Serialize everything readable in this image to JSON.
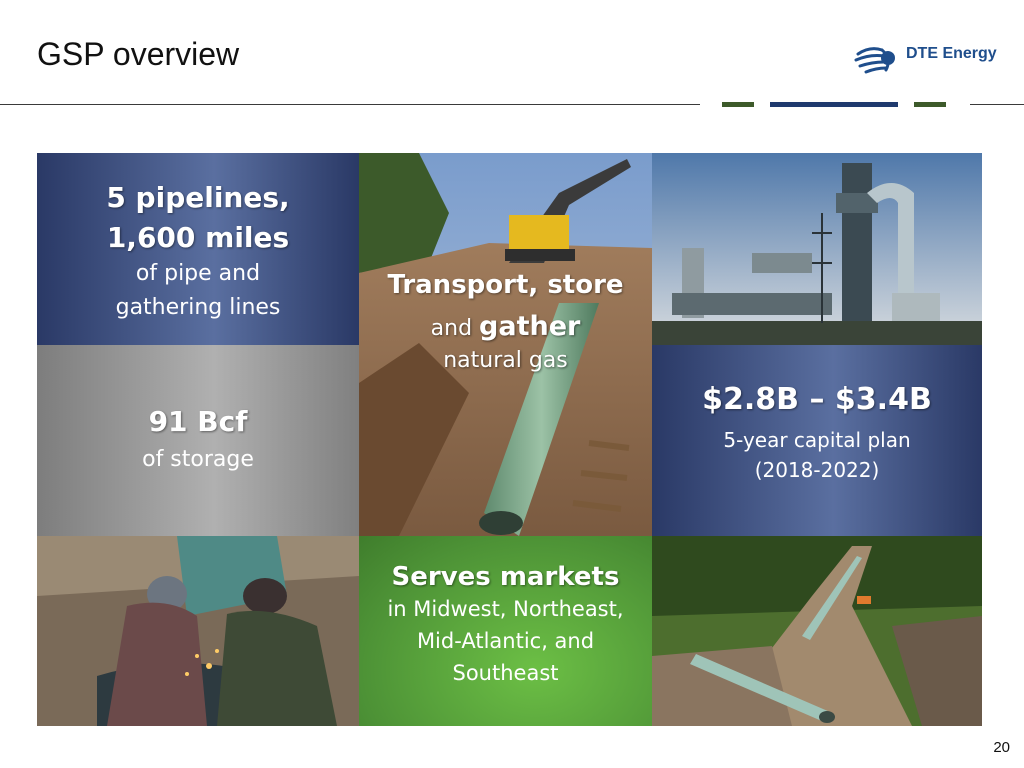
{
  "header": {
    "title": "GSP overview",
    "logo_text": "DTE Energy"
  },
  "tiles": {
    "pipelines": {
      "headline": "5 pipelines, 1,600 miles",
      "line1": "5 pipelines,",
      "line2": "1,600 miles",
      "sub1": "of pipe and",
      "sub2": "gathering lines"
    },
    "transport": {
      "line1": "Transport, store",
      "and_word": "and",
      "gather_word": "gather",
      "sub": "natural gas"
    },
    "storage": {
      "headline": "91 Bcf",
      "sub": "of storage"
    },
    "capital": {
      "headline": "$2.8B – $3.4B",
      "sub1": "5-year capital plan",
      "sub2": "(2018-2022)"
    },
    "markets": {
      "headline": "Serves markets",
      "sub1": "in Midwest, Northeast,",
      "sub2": "Mid-Atlantic, and",
      "sub3": "Southeast"
    }
  },
  "images": {
    "excavator": "trench-excavator-photo",
    "plant": "gas-facility-photo",
    "welders": "welders-photo",
    "pipeline_row": "pipeline-right-of-way-photo"
  },
  "colors": {
    "navy": "#2b3a6b",
    "grey": "#8c8c8c",
    "green": "#5aa23e",
    "accent_green": "#3d5a2a",
    "accent_navy": "#1f3a6e"
  },
  "footer": {
    "page_number": "20"
  }
}
